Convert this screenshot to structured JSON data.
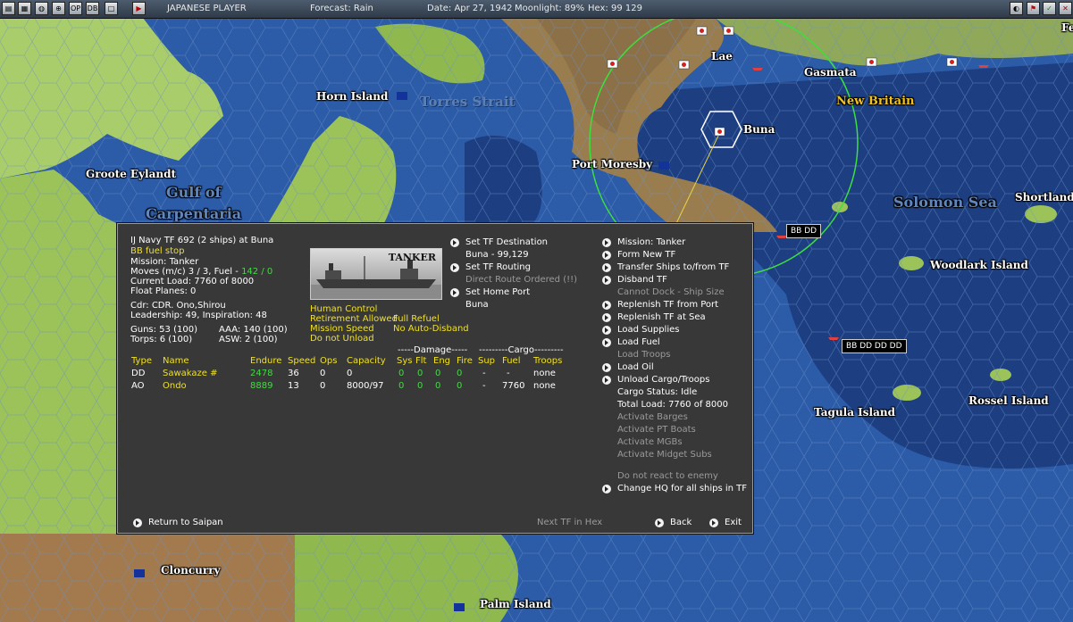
{
  "topbar": {
    "side": "JAPANESE PLAYER",
    "forecast": "Forecast: Rain",
    "date": "Date: Apr 27, 1942",
    "moonlight": "Moonlight: 89%",
    "hex": "Hex: 99 129",
    "button_op": "OP",
    "button_db": "DB"
  },
  "map_labels": {
    "horn_island": "Horn Island",
    "torres_strait": "Torres Strait",
    "groote_eylandt": "Groote Eylandt",
    "gulf_of": "Gulf of",
    "carpentaria": "Carpentaria",
    "lae": "Lae",
    "gasmata": "Gasmata",
    "fe": "Fe",
    "new_britain": "New Britain",
    "buna": "Buna",
    "port_moresby": "Port Moresby",
    "solomon_sea": "Solomon Sea",
    "shortlands": "Shortlands",
    "woodlark_island": "Woodlark Island",
    "tagula_island": "Tagula Island",
    "rossel_island": "Rossel Island",
    "cloncurry": "Cloncurry",
    "palm_island": "Palm Island",
    "tf_badge_1": "BB DD",
    "tf_badge_2": "BB DD DD DD"
  },
  "tf": {
    "title": "IJ Navy TF 692 (2 ships) at Buna",
    "note": "BB fuel stop",
    "mission": "Mission: Tanker",
    "moves_prefix": "Moves (m/c) 3 / 3, Fuel -",
    "moves_fuel": "142 / 0",
    "current_load": "Current Load: 7760 of 8000",
    "float_planes": "Float Planes: 0",
    "commander": "Cdr: CDR. Ono,Shirou",
    "leadership": "Leadership: 49, Inspiration: 48",
    "guns": "Guns: 53 (100)",
    "aaa": "AAA: 140 (100)",
    "torps": "Torps: 6 (100)",
    "asw": "ASW: 2 (100)",
    "ship_image_label": "TANKER"
  },
  "settings": {
    "human_control": "Human Control",
    "retirement": "Retirement Allowed",
    "full_refuel": "Full Refuel",
    "mission_speed": "Mission Speed",
    "no_auto_disband": "No Auto-Disband",
    "do_not_unload": "Do not Unload"
  },
  "routing": {
    "set_destination": "Set TF Destination",
    "destination_value": "Buna - 99,129",
    "set_routing": "Set TF Routing",
    "routing_value": "Direct Route Ordered (!!)",
    "set_home_port": "Set Home Port",
    "home_port_value": "Buna"
  },
  "table": {
    "group_damage": "-----Damage-----",
    "group_cargo": "---------Cargo---------",
    "headers": {
      "type": "Type",
      "name": "Name",
      "endure": "Endure",
      "speed": "Speed",
      "ops": "Ops",
      "capacity": "Capacity",
      "sys": "Sys",
      "flt": "Flt",
      "eng": "Eng",
      "fire": "Fire",
      "sup": "Sup",
      "fuel": "Fuel",
      "troops": "Troops"
    },
    "rows": [
      {
        "type": "DD",
        "name": "Sawakaze #",
        "endure": "2478",
        "speed": "36",
        "ops": "0",
        "capacity": "0",
        "sys": "0",
        "flt": "0",
        "eng": "0",
        "fire": "0",
        "sup": "-",
        "fuel": "-",
        "troops": "none"
      },
      {
        "type": "AO",
        "name": "Ondo",
        "endure": "8889",
        "speed": "13",
        "ops": "0",
        "capacity": "8000/97",
        "sys": "0",
        "flt": "0",
        "eng": "0",
        "fire": "0",
        "sup": "-",
        "fuel": "7760",
        "troops": "none"
      }
    ]
  },
  "commands": {
    "mission": "Mission: Tanker",
    "form_new_tf": "Form New TF",
    "transfer_ships": "Transfer Ships to/from TF",
    "disband_tf": "Disband TF",
    "cannot_dock": "Cannot Dock - Ship Size",
    "replenish_port": "Replenish TF from Port",
    "replenish_sea": "Replenish TF at Sea",
    "load_supplies": "Load Supplies",
    "load_fuel": "Load Fuel",
    "load_troops": "Load Troops",
    "load_oil": "Load Oil",
    "unload_cargo": "Unload Cargo/Troops",
    "cargo_status": "Cargo Status: Idle",
    "total_load": "Total Load: 7760 of 8000",
    "activate_barges": "Activate Barges",
    "activate_pt": "Activate PT Boats",
    "activate_mgb": "Activate MGBs",
    "activate_midget": "Activate Midget Subs",
    "do_not_react": "Do not react to enemy",
    "change_hq": "Change HQ for all ships in TF"
  },
  "footer": {
    "return": "Return to Saipan",
    "next_tf": "Next TF in Hex",
    "back": "Back",
    "exit": "Exit"
  },
  "colors": {
    "ocean_deep": "#1e3f80",
    "ocean_shallow": "#3c63a8",
    "land_green": "#9cc25a",
    "land_brown": "#a08050",
    "panel_bg": "#383838",
    "highlight_yellow": "#f0e020",
    "value_green": "#46d846"
  }
}
